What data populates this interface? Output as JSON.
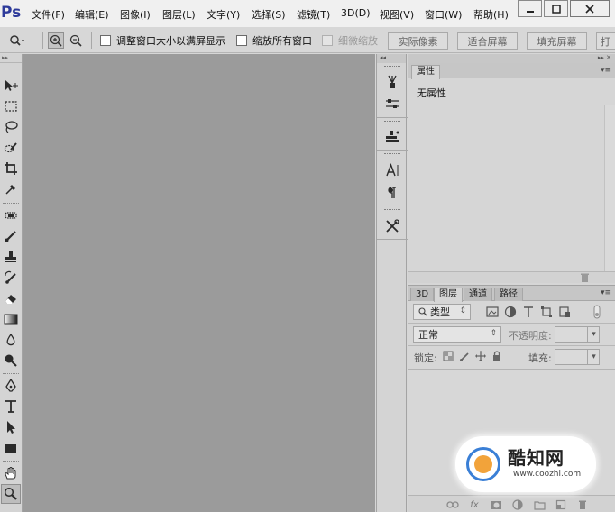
{
  "app": {
    "logo": "Ps"
  },
  "menu": [
    {
      "id": "file",
      "label": "文件(F)"
    },
    {
      "id": "edit",
      "label": "编辑(E)"
    },
    {
      "id": "image",
      "label": "图像(I)"
    },
    {
      "id": "layer",
      "label": "图层(L)"
    },
    {
      "id": "type",
      "label": "文字(Y)"
    },
    {
      "id": "select",
      "label": "选择(S)"
    },
    {
      "id": "filter",
      "label": "滤镜(T)"
    },
    {
      "id": "3d",
      "label": "3D(D)"
    },
    {
      "id": "view",
      "label": "视图(V)"
    },
    {
      "id": "window",
      "label": "窗口(W)"
    },
    {
      "id": "help",
      "label": "帮助(H)"
    }
  ],
  "window_controls": {
    "minimize": "▁",
    "maximize": "□",
    "close": "✕"
  },
  "options": {
    "resize_windows_label": "调整窗口大小以满屏显示",
    "zoom_all_label": "缩放所有窗口",
    "scrubby_zoom_label": "细微缩放",
    "actual_pixels": "实际像素",
    "fit_screen": "适合屏幕",
    "fill_screen": "填充屏幕",
    "print_size_partial": "打"
  },
  "toolbar": {
    "tools": [
      {
        "name": "move-tool",
        "icon": "move-icon"
      },
      {
        "name": "marquee-tool",
        "icon": "marquee-icon"
      },
      {
        "name": "lasso-tool",
        "icon": "lasso-icon"
      },
      {
        "name": "quick-select-tool",
        "icon": "quick-select-icon"
      },
      {
        "name": "crop-tool",
        "icon": "crop-icon"
      },
      {
        "name": "eyedropper-tool",
        "icon": "eyedropper-icon"
      },
      {
        "name": "healing-tool",
        "icon": "healing-icon"
      },
      {
        "name": "brush-tool",
        "icon": "brush-icon"
      },
      {
        "name": "stamp-tool",
        "icon": "stamp-icon"
      },
      {
        "name": "history-brush-tool",
        "icon": "history-brush-icon"
      },
      {
        "name": "eraser-tool",
        "icon": "eraser-icon"
      },
      {
        "name": "gradient-tool",
        "icon": "gradient-icon"
      },
      {
        "name": "blur-tool",
        "icon": "blur-icon"
      },
      {
        "name": "dodge-tool",
        "icon": "dodge-icon"
      },
      {
        "name": "pen-tool",
        "icon": "pen-icon"
      },
      {
        "name": "type-tool",
        "icon": "type-icon"
      },
      {
        "name": "path-select-tool",
        "icon": "path-select-icon"
      },
      {
        "name": "shape-tool",
        "icon": "rectangle-shape-icon"
      },
      {
        "name": "hand-tool",
        "icon": "hand-icon"
      },
      {
        "name": "zoom-tool",
        "icon": "zoom-icon",
        "active": true
      }
    ]
  },
  "properties_panel": {
    "tab": "属性",
    "empty_text": "无属性"
  },
  "layers_panel": {
    "tabs": [
      {
        "id": "3d",
        "label": "3D"
      },
      {
        "id": "layers",
        "label": "图层",
        "active": true
      },
      {
        "id": "channels",
        "label": "通道"
      },
      {
        "id": "paths",
        "label": "路径"
      }
    ],
    "filter_kind": "类型",
    "blend_mode": "正常",
    "opacity_label": "不透明度:",
    "lock_label": "锁定:",
    "fill_label": "填充:"
  },
  "watermark": {
    "title": "酷知网",
    "url": "www.coozhi.com"
  },
  "colors": {
    "canvas": "#9b9b9b",
    "panel": "#d6d6d6",
    "logo": "#2d3a9a"
  }
}
